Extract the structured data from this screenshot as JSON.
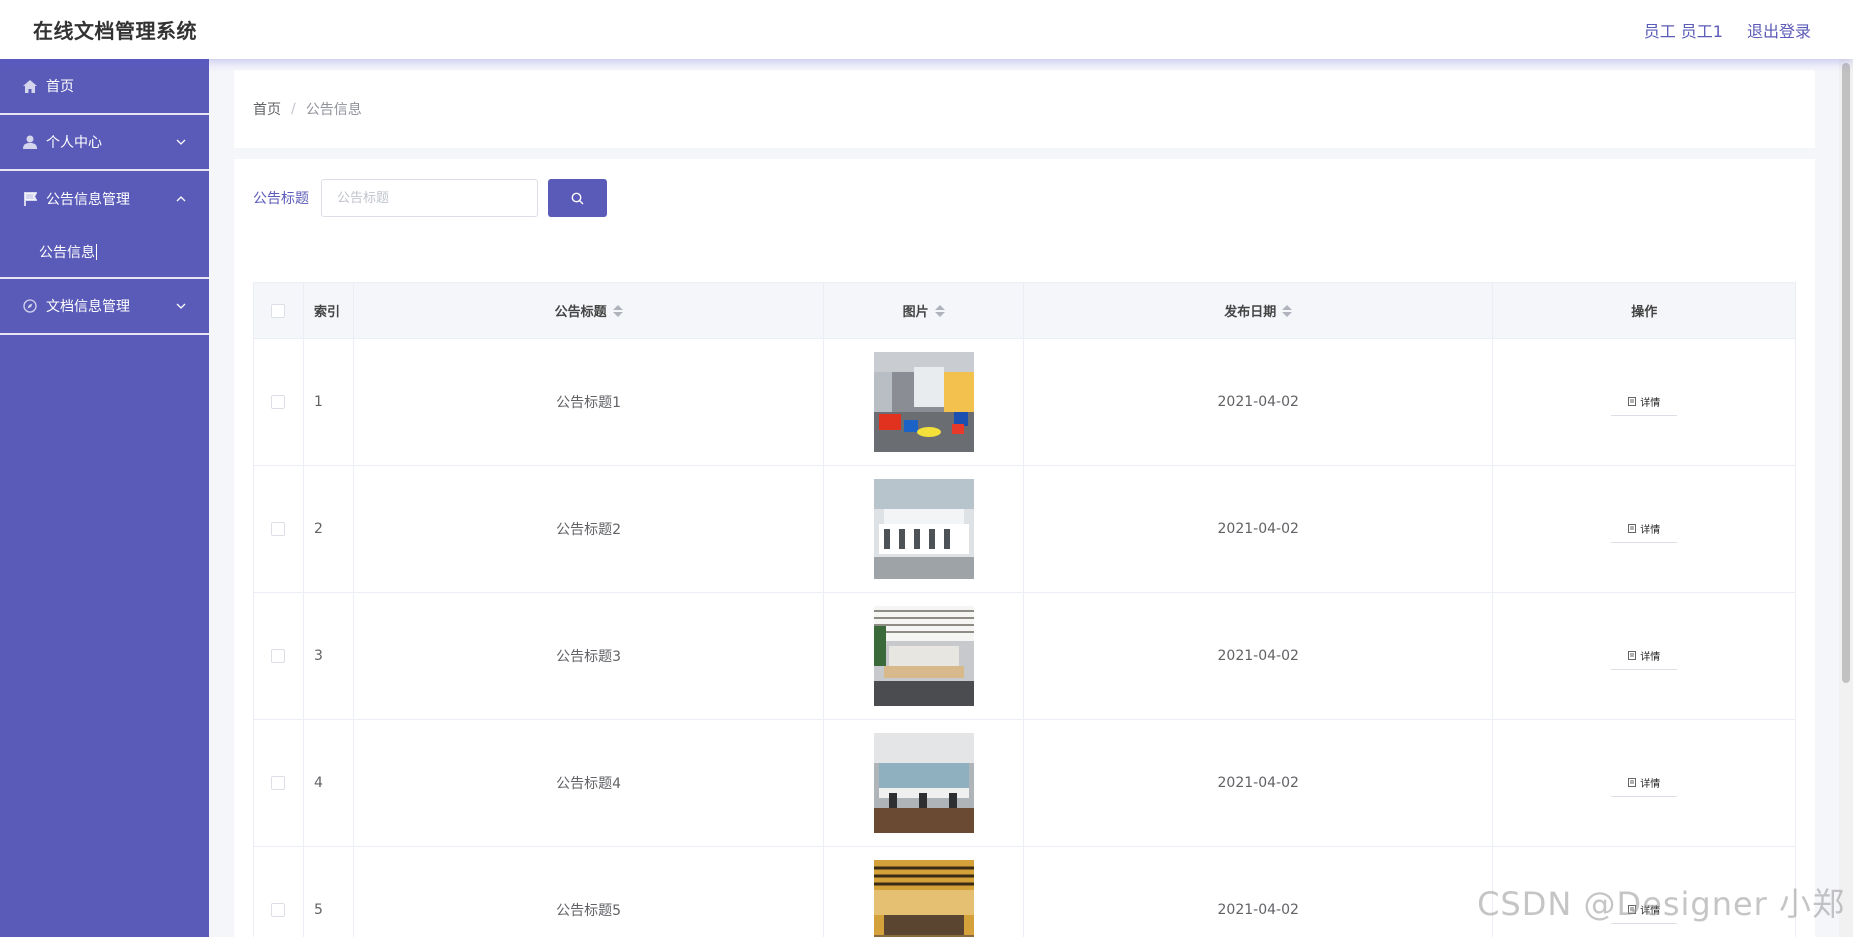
{
  "header": {
    "title": "在线文档管理系统",
    "user_label": "员工 员工1",
    "logout_label": "退出登录"
  },
  "sidebar": {
    "items": [
      {
        "label": "首页",
        "icon": "home-icon"
      },
      {
        "label": "个人中心",
        "icon": "user-icon",
        "expanded": false
      },
      {
        "label": "公告信息管理",
        "icon": "flag-icon",
        "expanded": true
      },
      {
        "label": "文档信息管理",
        "icon": "compass-icon",
        "expanded": false
      }
    ],
    "submenu_label": "公告信息"
  },
  "breadcrumb": {
    "home": "首页",
    "separator": "/",
    "current": "公告信息"
  },
  "search": {
    "label": "公告标题",
    "placeholder": "公告标题"
  },
  "table": {
    "headers": {
      "index": "索引",
      "title": "公告标题",
      "image": "图片",
      "date": "发布日期",
      "operation": "操作"
    },
    "detail_label": "详情",
    "rows": [
      {
        "index": "1",
        "title": "公告标题1",
        "date": "2021-04-02"
      },
      {
        "index": "2",
        "title": "公告标题2",
        "date": "2021-04-02"
      },
      {
        "index": "3",
        "title": "公告标题3",
        "date": "2021-04-02"
      },
      {
        "index": "4",
        "title": "公告标题4",
        "date": "2021-04-02"
      },
      {
        "index": "5",
        "title": "公告标题5",
        "date": "2021-04-02"
      }
    ]
  },
  "watermark": "CSDN @Designer 小郑",
  "colors": {
    "primary": "#5a5bb9",
    "link": "#5b5bb8"
  }
}
